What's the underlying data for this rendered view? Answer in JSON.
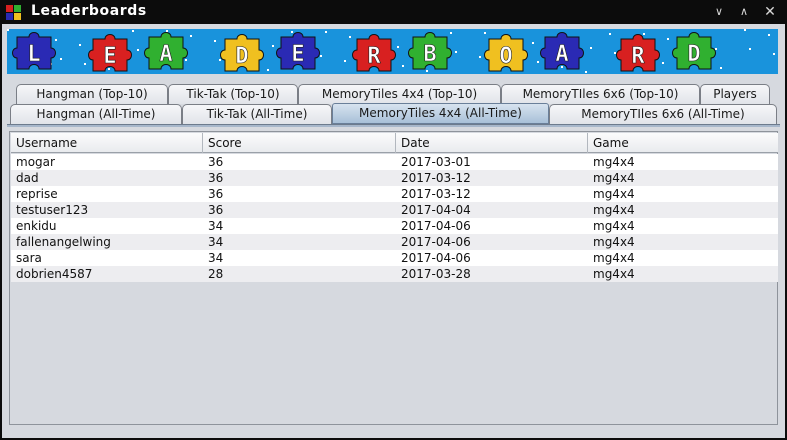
{
  "window": {
    "title": "Leaderboards",
    "app_icon": "puzzle-piece-icon",
    "controls": {
      "minimize": "∨",
      "maximize": "∧",
      "close": "✕"
    }
  },
  "banner": {
    "letters": [
      "L",
      "E",
      "A",
      "D",
      "E",
      "R",
      "B",
      "O",
      "A",
      "R",
      "D"
    ],
    "piece_colors": [
      "#2a2ab4",
      "#d82020",
      "#30b030",
      "#f0c020",
      "#2a2ab4",
      "#d82020",
      "#30b030",
      "#f0c020",
      "#2a2ab4",
      "#d82020",
      "#30b030"
    ],
    "background_color": "#1993dc"
  },
  "tabs": {
    "row1": [
      "Hangman (Top-10)",
      "Tik-Tak (Top-10)",
      "MemoryTiles 4x4 (Top-10)",
      "MemoryTIles 6x6 (Top-10)",
      "Players"
    ],
    "row2": [
      "Hangman (All-Time)",
      "Tik-Tak (All-Time)",
      "MemoryTiles 4x4 (All-Time)",
      "MemoryTIles 6x6 (All-Time)"
    ],
    "selected": "MemoryTiles 4x4 (All-Time)"
  },
  "table": {
    "columns": [
      "Username",
      "Score",
      "Date",
      "Game"
    ],
    "rows": [
      [
        "mogar",
        "36",
        "2017-03-01",
        "mg4x4"
      ],
      [
        "dad",
        "36",
        "2017-03-12",
        "mg4x4"
      ],
      [
        "reprise",
        "36",
        "2017-03-12",
        "mg4x4"
      ],
      [
        "testuser123",
        "36",
        "2017-04-04",
        "mg4x4"
      ],
      [
        "enkidu",
        "34",
        "2017-04-06",
        "mg4x4"
      ],
      [
        "fallenangelwing",
        "34",
        "2017-04-06",
        "mg4x4"
      ],
      [
        "sara",
        "34",
        "2017-04-06",
        "mg4x4"
      ],
      [
        "dobrien4587",
        "28",
        "2017-03-28",
        "mg4x4"
      ]
    ]
  }
}
